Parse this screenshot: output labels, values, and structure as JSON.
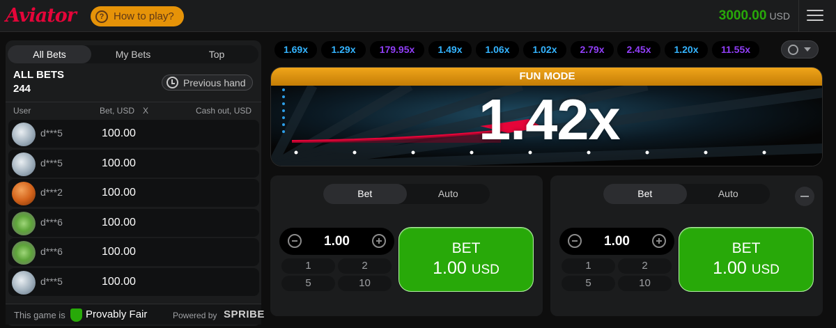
{
  "header": {
    "logo": "Aviator",
    "how_to_play": "How to play?",
    "balance": "3000.00",
    "currency": "USD"
  },
  "left": {
    "tabs": [
      "All Bets",
      "My Bets",
      "Top"
    ],
    "title": "ALL BETS",
    "count": "244",
    "previous_hand": "Previous hand",
    "columns": {
      "user": "User",
      "bet": "Bet, USD",
      "x": "X",
      "cashout": "Cash out, USD"
    },
    "rows": [
      {
        "user": "d***5",
        "bet": "100.00",
        "avatar": "money"
      },
      {
        "user": "d***5",
        "bet": "100.00",
        "avatar": "money"
      },
      {
        "user": "d***2",
        "bet": "100.00",
        "avatar": "ball"
      },
      {
        "user": "d***6",
        "bet": "100.00",
        "avatar": "clover"
      },
      {
        "user": "d***6",
        "bet": "100.00",
        "avatar": "clover"
      },
      {
        "user": "d***5",
        "bet": "100.00",
        "avatar": "money"
      }
    ],
    "footer": {
      "this_game_is": "This game is",
      "provably_fair": "Provably Fair",
      "powered_by": "Powered by",
      "brand": "SPRIBE"
    }
  },
  "history": [
    {
      "value": "1.69x",
      "color": "blue"
    },
    {
      "value": "1.29x",
      "color": "blue"
    },
    {
      "value": "179.95x",
      "color": "purple"
    },
    {
      "value": "1.49x",
      "color": "blue"
    },
    {
      "value": "1.06x",
      "color": "blue"
    },
    {
      "value": "1.02x",
      "color": "blue"
    },
    {
      "value": "2.79x",
      "color": "purple"
    },
    {
      "value": "2.45x",
      "color": "purple"
    },
    {
      "value": "1.20x",
      "color": "blue"
    },
    {
      "value": "11.55x",
      "color": "purple"
    }
  ],
  "game": {
    "banner": "FUN MODE",
    "multiplier": "1.42x"
  },
  "bet_panels": [
    {
      "tabs": [
        "Bet",
        "Auto"
      ],
      "amount": "1.00",
      "quick": [
        "1",
        "2",
        "5",
        "10"
      ],
      "bet_label": "BET",
      "bet_amount": "1.00",
      "bet_currency": "USD"
    },
    {
      "tabs": [
        "Bet",
        "Auto"
      ],
      "amount": "1.00",
      "quick": [
        "1",
        "2",
        "5",
        "10"
      ],
      "bet_label": "BET",
      "bet_amount": "1.00",
      "bet_currency": "USD"
    }
  ],
  "colors": {
    "brand_red": "#e50539",
    "orange": "#e69308",
    "green": "#28a909",
    "blue": "#34b4ff",
    "purple": "#913ef8"
  }
}
